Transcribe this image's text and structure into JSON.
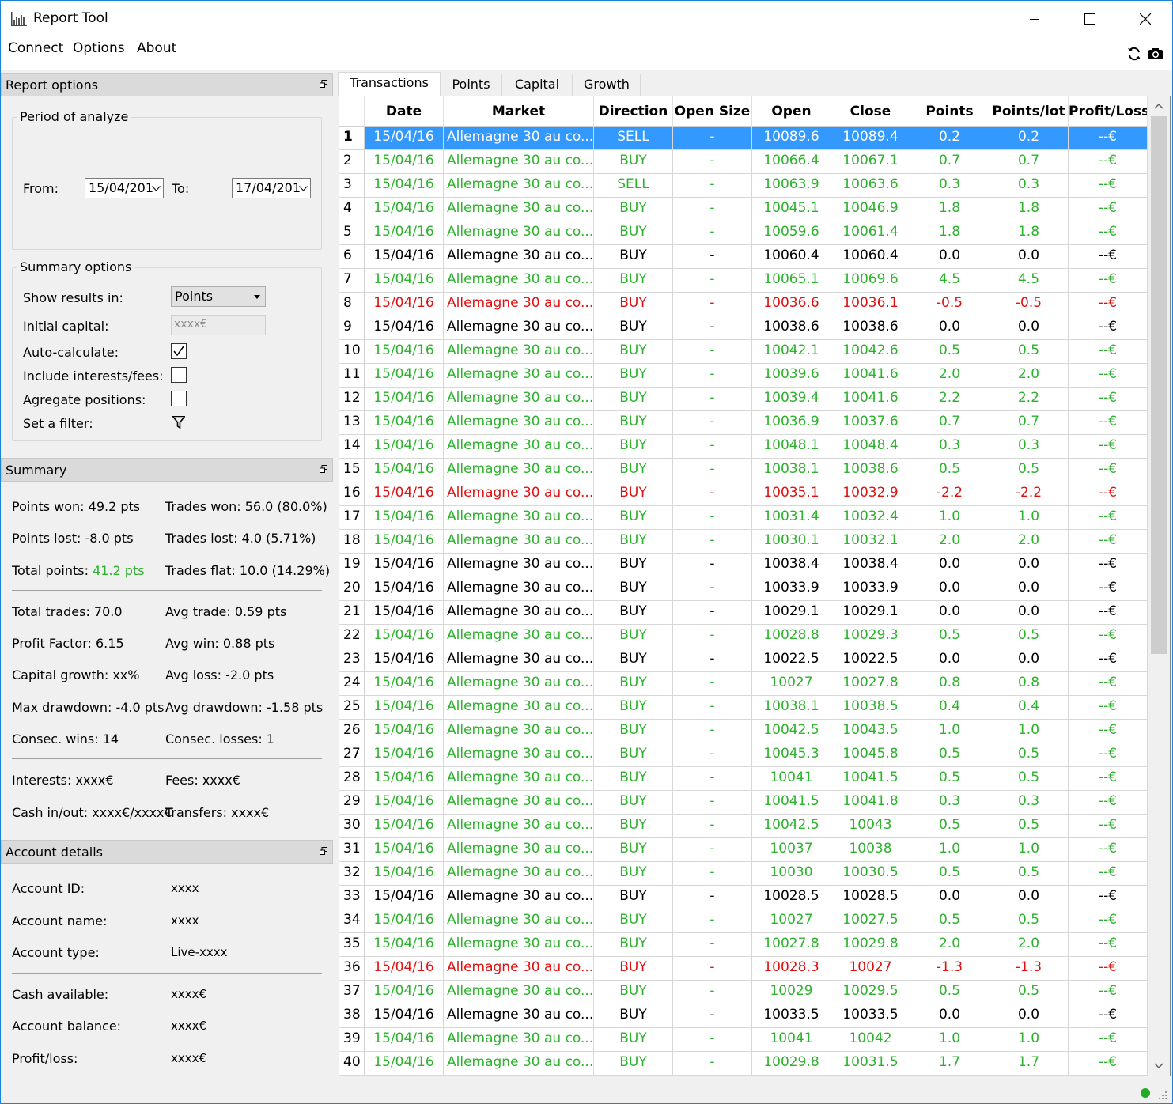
{
  "window": {
    "title": "Report Tool",
    "icon": "chart-icon"
  },
  "menu": {
    "items": [
      "Connect",
      "Options",
      "About"
    ],
    "refresh_icon": "refresh-icon",
    "camera_icon": "camera-icon"
  },
  "report_options": {
    "header": "Report options",
    "period_title": "Period of analyze",
    "from_label": "From:",
    "from_value": "15/04/201",
    "to_label": "To:",
    "to_value": "17/04/201",
    "summary_title": "Summary options",
    "show_results_label": "Show results in:",
    "show_results_value": "Points",
    "initial_capital_label": "Initial capital:",
    "initial_capital_placeholder": "xxxx€",
    "auto_calc_label": "Auto-calculate:",
    "auto_calc_checked": true,
    "interests_label": "Include interests/fees:",
    "interests_checked": false,
    "agregate_label": "Agregate positions:",
    "agregate_checked": false,
    "filter_label": "Set a filter:"
  },
  "summary": {
    "header": "Summary",
    "points_won": "Points won: 49.2 pts",
    "trades_won": "Trades won: 56.0 (80.0%)",
    "points_lost": "Points lost: -8.0 pts",
    "trades_lost": "Trades lost: 4.0 (5.71%)",
    "total_points_label": "Total points: ",
    "total_points_value": "41.2 pts",
    "trades_flat": "Trades flat: 10.0 (14.29%)",
    "total_trades": "Total trades: 70.0",
    "avg_trade": "Avg trade: 0.59 pts",
    "profit_factor": "Profit Factor: 6.15",
    "avg_win": "Avg win: 0.88 pts",
    "capital_growth": "Capital growth: xx%",
    "avg_loss": "Avg loss: -2.0 pts",
    "max_drawdown": "Max drawdown: -4.0 pts",
    "avg_drawdown": "Avg drawdown: -1.58 pts",
    "consec_wins": "Consec. wins: 14",
    "consec_losses": "Consec. losses: 1",
    "interests": "Interests: xxxx€",
    "fees": "Fees: xxxx€",
    "cash_inout": "Cash in/out: xxxx€/xxxx€",
    "transfers": "Transfers: xxxx€"
  },
  "account": {
    "header": "Account details",
    "id_label": "Account ID:",
    "id_value": "xxxx",
    "name_label": "Account name:",
    "name_value": "xxxx",
    "type_label": "Account type:",
    "type_value": "Live-xxxx",
    "cash_label": "Cash available:",
    "cash_value": "xxxx€",
    "balance_label": "Account balance:",
    "balance_value": "xxxx€",
    "pl_label": "Profit/loss:",
    "pl_value": "xxxx€"
  },
  "tabs": [
    "Transactions",
    "Points",
    "Capital",
    "Growth"
  ],
  "table": {
    "columns": [
      "Date",
      "Market",
      "Direction",
      "Open Size",
      "Open",
      "Close",
      "Points",
      "Points/lot",
      "Profit/Loss"
    ],
    "colors": {
      "green": "#2db22d",
      "red": "#e01010",
      "black": "#000000",
      "selected": "#3399ff"
    },
    "rows": [
      [
        "1",
        "15/04/16",
        "Allemagne 30 au co...",
        "SELL",
        "-",
        "10089.6",
        "10089.4",
        "0.2",
        "0.2",
        "--€",
        "sel"
      ],
      [
        "2",
        "15/04/16",
        "Allemagne 30 au co...",
        "BUY",
        "-",
        "10066.4",
        "10067.1",
        "0.7",
        "0.7",
        "--€",
        "green"
      ],
      [
        "3",
        "15/04/16",
        "Allemagne 30 au co...",
        "SELL",
        "-",
        "10063.9",
        "10063.6",
        "0.3",
        "0.3",
        "--€",
        "green"
      ],
      [
        "4",
        "15/04/16",
        "Allemagne 30 au co...",
        "BUY",
        "-",
        "10045.1",
        "10046.9",
        "1.8",
        "1.8",
        "--€",
        "green"
      ],
      [
        "5",
        "15/04/16",
        "Allemagne 30 au co...",
        "BUY",
        "-",
        "10059.6",
        "10061.4",
        "1.8",
        "1.8",
        "--€",
        "green"
      ],
      [
        "6",
        "15/04/16",
        "Allemagne 30 au co...",
        "BUY",
        "-",
        "10060.4",
        "10060.4",
        "0.0",
        "0.0",
        "--€",
        "black"
      ],
      [
        "7",
        "15/04/16",
        "Allemagne 30 au co...",
        "BUY",
        "-",
        "10065.1",
        "10069.6",
        "4.5",
        "4.5",
        "--€",
        "green"
      ],
      [
        "8",
        "15/04/16",
        "Allemagne 30 au co...",
        "BUY",
        "-",
        "10036.6",
        "10036.1",
        "-0.5",
        "-0.5",
        "--€",
        "red"
      ],
      [
        "9",
        "15/04/16",
        "Allemagne 30 au co...",
        "BUY",
        "-",
        "10038.6",
        "10038.6",
        "0.0",
        "0.0",
        "--€",
        "black"
      ],
      [
        "10",
        "15/04/16",
        "Allemagne 30 au co...",
        "BUY",
        "-",
        "10042.1",
        "10042.6",
        "0.5",
        "0.5",
        "--€",
        "green"
      ],
      [
        "11",
        "15/04/16",
        "Allemagne 30 au co...",
        "BUY",
        "-",
        "10039.6",
        "10041.6",
        "2.0",
        "2.0",
        "--€",
        "green"
      ],
      [
        "12",
        "15/04/16",
        "Allemagne 30 au co...",
        "BUY",
        "-",
        "10039.4",
        "10041.6",
        "2.2",
        "2.2",
        "--€",
        "green"
      ],
      [
        "13",
        "15/04/16",
        "Allemagne 30 au co...",
        "BUY",
        "-",
        "10036.9",
        "10037.6",
        "0.7",
        "0.7",
        "--€",
        "green"
      ],
      [
        "14",
        "15/04/16",
        "Allemagne 30 au co...",
        "BUY",
        "-",
        "10048.1",
        "10048.4",
        "0.3",
        "0.3",
        "--€",
        "green"
      ],
      [
        "15",
        "15/04/16",
        "Allemagne 30 au co...",
        "BUY",
        "-",
        "10038.1",
        "10038.6",
        "0.5",
        "0.5",
        "--€",
        "green"
      ],
      [
        "16",
        "15/04/16",
        "Allemagne 30 au co...",
        "BUY",
        "-",
        "10035.1",
        "10032.9",
        "-2.2",
        "-2.2",
        "--€",
        "red"
      ],
      [
        "17",
        "15/04/16",
        "Allemagne 30 au co...",
        "BUY",
        "-",
        "10031.4",
        "10032.4",
        "1.0",
        "1.0",
        "--€",
        "green"
      ],
      [
        "18",
        "15/04/16",
        "Allemagne 30 au co...",
        "BUY",
        "-",
        "10030.1",
        "10032.1",
        "2.0",
        "2.0",
        "--€",
        "green"
      ],
      [
        "19",
        "15/04/16",
        "Allemagne 30 au co...",
        "BUY",
        "-",
        "10038.4",
        "10038.4",
        "0.0",
        "0.0",
        "--€",
        "black"
      ],
      [
        "20",
        "15/04/16",
        "Allemagne 30 au co...",
        "BUY",
        "-",
        "10033.9",
        "10033.9",
        "0.0",
        "0.0",
        "--€",
        "black"
      ],
      [
        "21",
        "15/04/16",
        "Allemagne 30 au co...",
        "BUY",
        "-",
        "10029.1",
        "10029.1",
        "0.0",
        "0.0",
        "--€",
        "black"
      ],
      [
        "22",
        "15/04/16",
        "Allemagne 30 au co...",
        "BUY",
        "-",
        "10028.8",
        "10029.3",
        "0.5",
        "0.5",
        "--€",
        "green"
      ],
      [
        "23",
        "15/04/16",
        "Allemagne 30 au co...",
        "BUY",
        "-",
        "10022.5",
        "10022.5",
        "0.0",
        "0.0",
        "--€",
        "black"
      ],
      [
        "24",
        "15/04/16",
        "Allemagne 30 au co...",
        "BUY",
        "-",
        "10027",
        "10027.8",
        "0.8",
        "0.8",
        "--€",
        "green"
      ],
      [
        "25",
        "15/04/16",
        "Allemagne 30 au co...",
        "BUY",
        "-",
        "10038.1",
        "10038.5",
        "0.4",
        "0.4",
        "--€",
        "green"
      ],
      [
        "26",
        "15/04/16",
        "Allemagne 30 au co...",
        "BUY",
        "-",
        "10042.5",
        "10043.5",
        "1.0",
        "1.0",
        "--€",
        "green"
      ],
      [
        "27",
        "15/04/16",
        "Allemagne 30 au co...",
        "BUY",
        "-",
        "10045.3",
        "10045.8",
        "0.5",
        "0.5",
        "--€",
        "green"
      ],
      [
        "28",
        "15/04/16",
        "Allemagne 30 au co...",
        "BUY",
        "-",
        "10041",
        "10041.5",
        "0.5",
        "0.5",
        "--€",
        "green"
      ],
      [
        "29",
        "15/04/16",
        "Allemagne 30 au co...",
        "BUY",
        "-",
        "10041.5",
        "10041.8",
        "0.3",
        "0.3",
        "--€",
        "green"
      ],
      [
        "30",
        "15/04/16",
        "Allemagne 30 au co...",
        "BUY",
        "-",
        "10042.5",
        "10043",
        "0.5",
        "0.5",
        "--€",
        "green"
      ],
      [
        "31",
        "15/04/16",
        "Allemagne 30 au co...",
        "BUY",
        "-",
        "10037",
        "10038",
        "1.0",
        "1.0",
        "--€",
        "green"
      ],
      [
        "32",
        "15/04/16",
        "Allemagne 30 au co...",
        "BUY",
        "-",
        "10030",
        "10030.5",
        "0.5",
        "0.5",
        "--€",
        "green"
      ],
      [
        "33",
        "15/04/16",
        "Allemagne 30 au co...",
        "BUY",
        "-",
        "10028.5",
        "10028.5",
        "0.0",
        "0.0",
        "--€",
        "black"
      ],
      [
        "34",
        "15/04/16",
        "Allemagne 30 au co...",
        "BUY",
        "-",
        "10027",
        "10027.5",
        "0.5",
        "0.5",
        "--€",
        "green"
      ],
      [
        "35",
        "15/04/16",
        "Allemagne 30 au co...",
        "BUY",
        "-",
        "10027.8",
        "10029.8",
        "2.0",
        "2.0",
        "--€",
        "green"
      ],
      [
        "36",
        "15/04/16",
        "Allemagne 30 au co...",
        "BUY",
        "-",
        "10028.3",
        "10027",
        "-1.3",
        "-1.3",
        "--€",
        "red"
      ],
      [
        "37",
        "15/04/16",
        "Allemagne 30 au co...",
        "BUY",
        "-",
        "10029",
        "10029.5",
        "0.5",
        "0.5",
        "--€",
        "green"
      ],
      [
        "38",
        "15/04/16",
        "Allemagne 30 au co...",
        "BUY",
        "-",
        "10033.5",
        "10033.5",
        "0.0",
        "0.0",
        "--€",
        "black"
      ],
      [
        "39",
        "15/04/16",
        "Allemagne 30 au co...",
        "BUY",
        "-",
        "10041",
        "10042",
        "1.0",
        "1.0",
        "--€",
        "green"
      ],
      [
        "40",
        "15/04/16",
        "Allemagne 30 au co...",
        "BUY",
        "-",
        "10029.8",
        "10031.5",
        "1.7",
        "1.7",
        "--€",
        "green"
      ]
    ]
  },
  "status": {
    "connected_color": "#22aa22"
  }
}
